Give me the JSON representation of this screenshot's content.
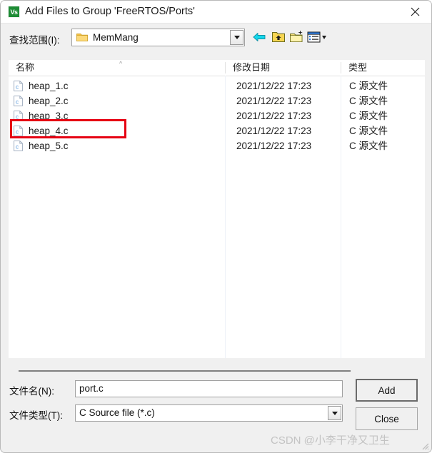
{
  "window": {
    "title": "Add Files to Group 'FreeRTOS/Ports'",
    "app_icon_text": "Vs",
    "close_icon": "close-icon"
  },
  "toolbar": {
    "look_in_label": "查找范围(I):",
    "current_folder": "MemMang",
    "folder_icon": "folder-icon",
    "dropdown_icon": "chevron-down-icon",
    "buttons": [
      {
        "name": "back-button",
        "icon": "back-arrow-icon",
        "tooltip": "后退"
      },
      {
        "name": "up-one-level-button",
        "icon": "up-folder-icon",
        "tooltip": "上一级"
      },
      {
        "name": "new-folder-button",
        "icon": "new-folder-icon",
        "tooltip": "新建文件夹"
      },
      {
        "name": "views-button",
        "icon": "views-list-icon",
        "tooltip": "查看"
      }
    ]
  },
  "file_list": {
    "columns": [
      {
        "key": "name",
        "label": "名称",
        "sorted": "asc",
        "sort_icon": "sort-asc-icon"
      },
      {
        "key": "date",
        "label": "修改日期"
      },
      {
        "key": "type",
        "label": "类型"
      }
    ],
    "rows": [
      {
        "icon": "c-source-file-icon",
        "name": "heap_1.c",
        "date": "2021/12/22 17:23",
        "type": "C 源文件"
      },
      {
        "icon": "c-source-file-icon",
        "name": "heap_2.c",
        "date": "2021/12/22 17:23",
        "type": "C 源文件"
      },
      {
        "icon": "c-source-file-icon",
        "name": "heap_3.c",
        "date": "2021/12/22 17:23",
        "type": "C 源文件"
      },
      {
        "icon": "c-source-file-icon",
        "name": "heap_4.c",
        "date": "2021/12/22 17:23",
        "type": "C 源文件"
      },
      {
        "icon": "c-source-file-icon",
        "name": "heap_5.c",
        "date": "2021/12/22 17:23",
        "type": "C 源文件"
      }
    ]
  },
  "annotation": {
    "type": "rectangle-highlight",
    "target_row": "heap_4.c",
    "color": "#e60012"
  },
  "form": {
    "filename_label": "文件名(N):",
    "filename_value": "port.c",
    "filetype_label": "文件类型(T):",
    "filetype_value": "C Source file (*.c)",
    "filetype_dropdown_icon": "chevron-down-icon"
  },
  "buttons": {
    "add": "Add",
    "close": "Close"
  },
  "watermark": {
    "text": "CSDN @小李干净又卫生"
  }
}
